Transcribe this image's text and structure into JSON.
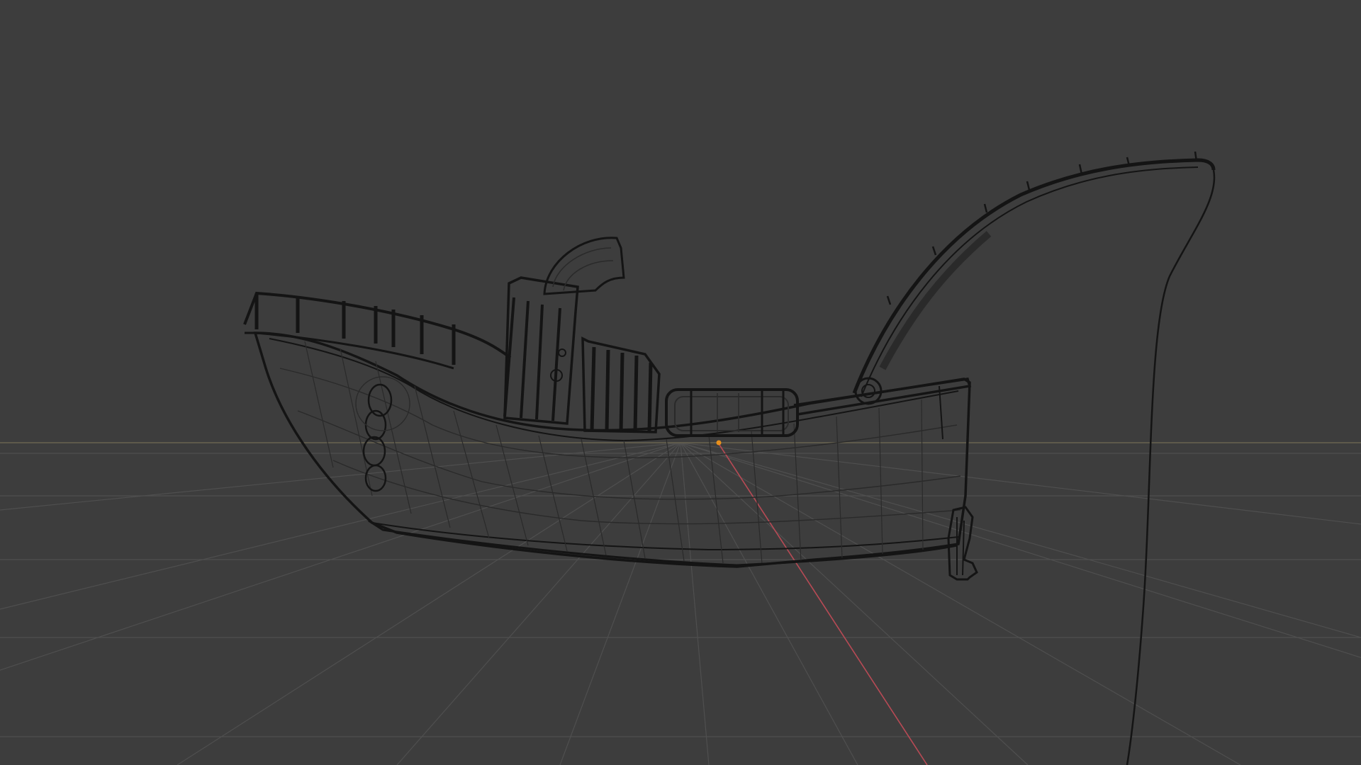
{
  "viewport": {
    "mode": "wireframe",
    "background_color": "#3d3d3d",
    "grid_color": "#4f4f4f",
    "horizon_color": "#6a6450",
    "x_axis_color": "#b84a55",
    "wire_color": "#141414",
    "wire_light_color": "#2a2a2a",
    "origin_color": "#e8901c",
    "object": "fishing-boat"
  }
}
